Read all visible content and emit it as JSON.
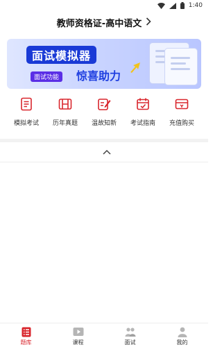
{
  "status_bar": {
    "time": "1:40"
  },
  "header": {
    "title": "教师资格证-高中语文"
  },
  "banner": {
    "title": "面试模拟器",
    "subtitle": "惊喜助力",
    "tag": "面试功能"
  },
  "quick_menu": [
    {
      "label": "模拟考试",
      "icon": "exam-paper-icon"
    },
    {
      "label": "历年真题",
      "icon": "past-papers-icon"
    },
    {
      "label": "温故知新",
      "icon": "review-icon"
    },
    {
      "label": "考试指南",
      "icon": "calendar-guide-icon"
    },
    {
      "label": "充值购买",
      "icon": "purchase-icon"
    }
  ],
  "tabbar": [
    {
      "label": "题库",
      "icon": "question-bank-icon",
      "active": true
    },
    {
      "label": "课程",
      "icon": "video-course-icon",
      "active": false
    },
    {
      "label": "面试",
      "icon": "interview-icon",
      "active": false
    },
    {
      "label": "我的",
      "icon": "profile-icon",
      "active": false
    }
  ],
  "colors": {
    "accent": "#d9262d",
    "banner_blue": "#1a3ad6",
    "icon_gray": "#999999"
  }
}
